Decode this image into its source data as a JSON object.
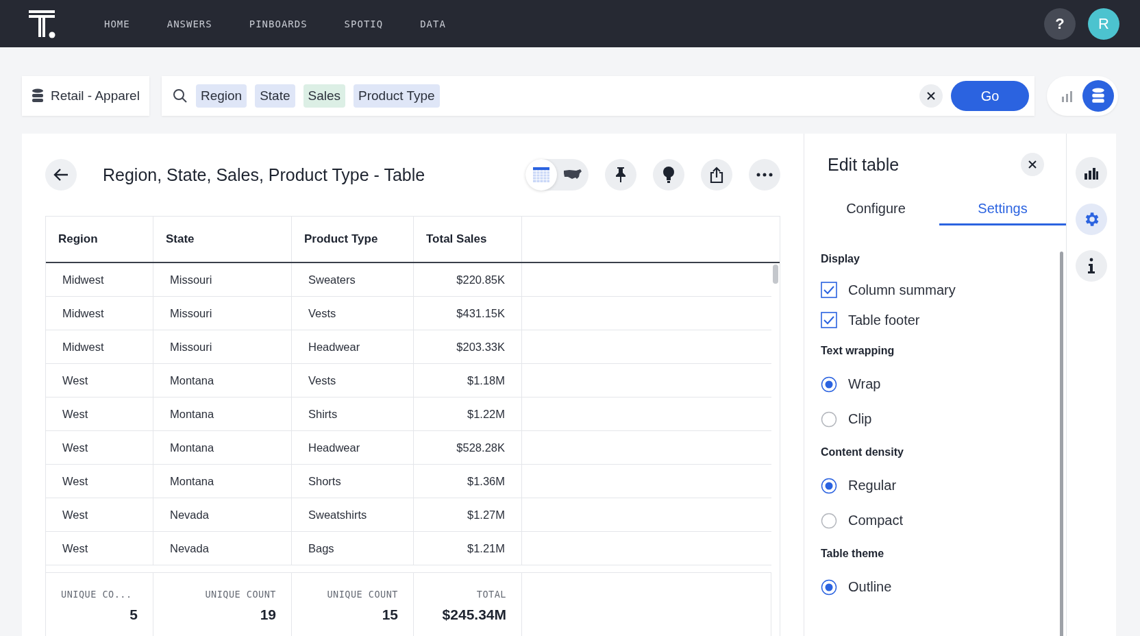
{
  "nav": {
    "items": [
      {
        "label": "HOME",
        "selected": false
      },
      {
        "label": "ANSWERS",
        "selected": false
      },
      {
        "label": "PINBOARDS",
        "selected": false
      },
      {
        "label": "SPOTIQ",
        "selected": false
      },
      {
        "label": "DATA",
        "selected": false
      }
    ],
    "help": "?",
    "avatar": "R"
  },
  "source": {
    "label": "Retail - Apparel"
  },
  "search": {
    "tokens": [
      {
        "label": "Region",
        "kind": "attribute"
      },
      {
        "label": "State",
        "kind": "attribute"
      },
      {
        "label": "Sales",
        "kind": "measure"
      },
      {
        "label": "Product Type",
        "kind": "attribute"
      }
    ],
    "go": "Go"
  },
  "answer": {
    "title": "Region, State, Sales, Product Type - Table",
    "view_toggle": [
      {
        "kind": "table",
        "selected": true
      },
      {
        "kind": "map",
        "selected": false
      }
    ]
  },
  "table": {
    "columns": [
      {
        "label": "Region",
        "kind": "attribute"
      },
      {
        "label": "State",
        "kind": "attribute"
      },
      {
        "label": "Product Type",
        "kind": "attribute"
      },
      {
        "label": "Total Sales",
        "kind": "measure"
      }
    ],
    "rows": [
      [
        "Midwest",
        "Missouri",
        "Sweaters",
        "$220.85K"
      ],
      [
        "Midwest",
        "Missouri",
        "Vests",
        "$431.15K"
      ],
      [
        "Midwest",
        "Missouri",
        "Headwear",
        "$203.33K"
      ],
      [
        "West",
        "Montana",
        "Vests",
        "$1.18M"
      ],
      [
        "West",
        "Montana",
        "Shirts",
        "$1.22M"
      ],
      [
        "West",
        "Montana",
        "Headwear",
        "$528.28K"
      ],
      [
        "West",
        "Montana",
        "Shorts",
        "$1.36M"
      ],
      [
        "West",
        "Nevada",
        "Sweatshirts",
        "$1.27M"
      ],
      [
        "West",
        "Nevada",
        "Bags",
        "$1.21M"
      ]
    ],
    "summary": [
      {
        "label": "UNIQUE CO...",
        "value": "5"
      },
      {
        "label": "UNIQUE COUNT",
        "value": "19"
      },
      {
        "label": "UNIQUE COUNT",
        "value": "15"
      },
      {
        "label": "TOTAL",
        "value": "$245.34M"
      }
    ]
  },
  "edit_panel": {
    "title": "Edit table",
    "tabs": [
      {
        "label": "Configure",
        "selected": false
      },
      {
        "label": "Settings",
        "selected": true
      }
    ],
    "sections": [
      {
        "title": "Display",
        "kind": "checkbox",
        "options": [
          {
            "label": "Column summary",
            "checked": true
          },
          {
            "label": "Table footer",
            "checked": true
          }
        ]
      },
      {
        "title": "Text wrapping",
        "kind": "radio",
        "options": [
          {
            "label": "Wrap",
            "selected": true
          },
          {
            "label": "Clip",
            "selected": false
          }
        ]
      },
      {
        "title": "Content density",
        "kind": "radio",
        "options": [
          {
            "label": "Regular",
            "selected": true
          },
          {
            "label": "Compact",
            "selected": false
          }
        ]
      },
      {
        "title": "Table theme",
        "kind": "radio",
        "options": [
          {
            "label": "Outline",
            "selected": true
          }
        ]
      }
    ]
  },
  "rail": [
    {
      "kind": "chart",
      "selected": false
    },
    {
      "kind": "settings",
      "selected": true
    },
    {
      "kind": "info",
      "selected": false
    }
  ]
}
